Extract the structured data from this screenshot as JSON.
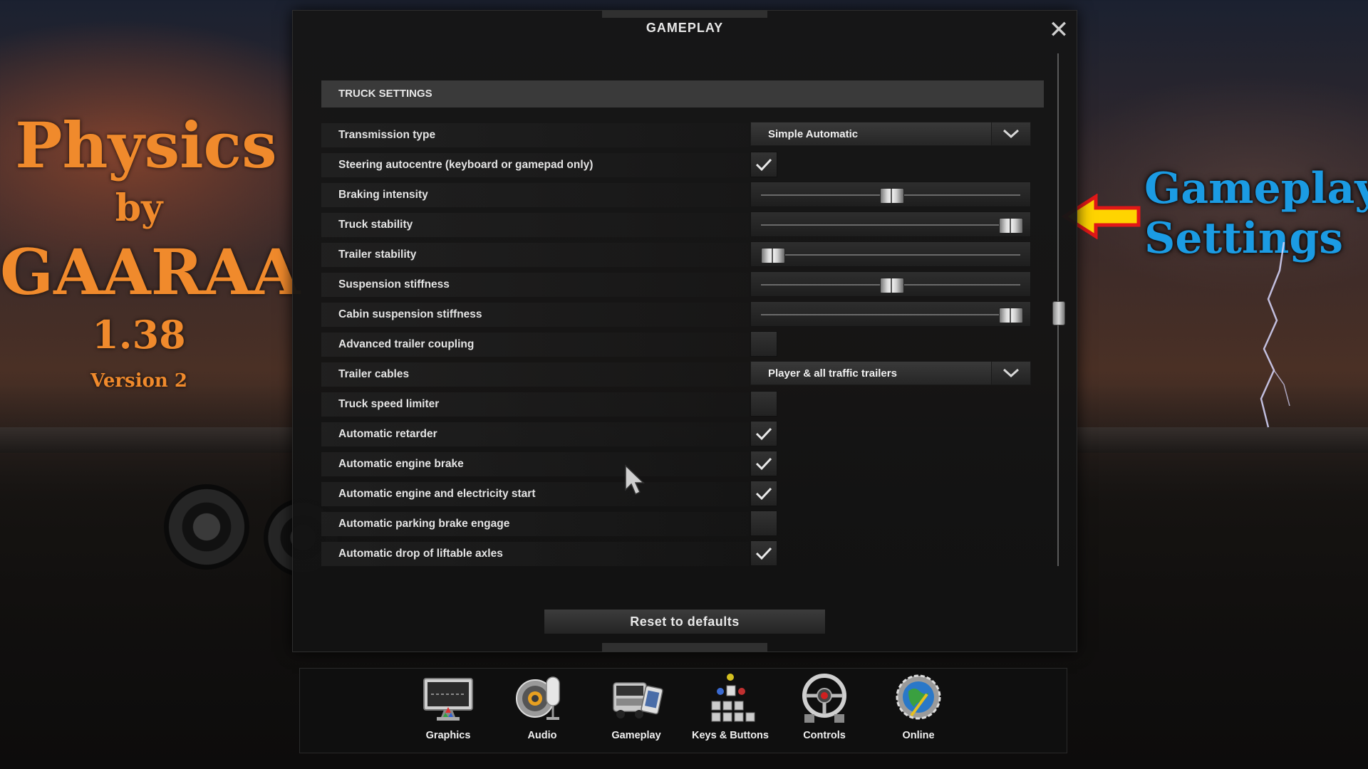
{
  "promo": {
    "line1": "Physics",
    "line2": "by",
    "line3": "GAARAA",
    "line4": "1.38",
    "line5": "Version 2"
  },
  "annotation": {
    "line1": "Gameplay",
    "line2": "Settings",
    "color": "#1b9be3",
    "arrow_color": "#ffd400",
    "arrow_outline": "#e01818"
  },
  "dialog": {
    "title": "GAMEPLAY",
    "close_icon": "close-icon",
    "section_title": "TRUCK SETTINGS",
    "reset_label": "Reset to defaults",
    "scroll_position": 0.55
  },
  "settings": [
    {
      "label": "Transmission type",
      "type": "dropdown",
      "value": "Simple Automatic"
    },
    {
      "label": "Steering autocentre (keyboard or gamepad only)",
      "type": "checkbox",
      "checked": true
    },
    {
      "label": "Braking intensity",
      "type": "slider",
      "value": 0.5
    },
    {
      "label": "Truck stability",
      "type": "slider",
      "value": 1.0
    },
    {
      "label": "Trailer stability",
      "type": "slider",
      "value": 0.0
    },
    {
      "label": "Suspension stiffness",
      "type": "slider",
      "value": 0.5
    },
    {
      "label": "Cabin suspension stiffness",
      "type": "slider",
      "value": 1.0
    },
    {
      "label": "Advanced trailer coupling",
      "type": "checkbox",
      "checked": false
    },
    {
      "label": "Trailer cables",
      "type": "dropdown",
      "value": "Player & all traffic trailers"
    },
    {
      "label": "Truck speed limiter",
      "type": "checkbox",
      "checked": false
    },
    {
      "label": "Automatic retarder",
      "type": "checkbox",
      "checked": true
    },
    {
      "label": "Automatic engine brake",
      "type": "checkbox",
      "checked": true
    },
    {
      "label": "Automatic engine and electricity start",
      "type": "checkbox",
      "checked": true
    },
    {
      "label": "Automatic parking brake engage",
      "type": "checkbox",
      "checked": false
    },
    {
      "label": "Automatic drop of liftable axles",
      "type": "checkbox",
      "checked": true
    }
  ],
  "nav": [
    {
      "label": "Graphics",
      "icon": "monitor-icon"
    },
    {
      "label": "Audio",
      "icon": "speaker-microphone-icon"
    },
    {
      "label": "Gameplay",
      "icon": "truck-icon"
    },
    {
      "label": "Keys & Buttons",
      "icon": "keys-buttons-icon"
    },
    {
      "label": "Controls",
      "icon": "steering-wheel-icon"
    },
    {
      "label": "Online",
      "icon": "globe-gear-icon"
    }
  ]
}
